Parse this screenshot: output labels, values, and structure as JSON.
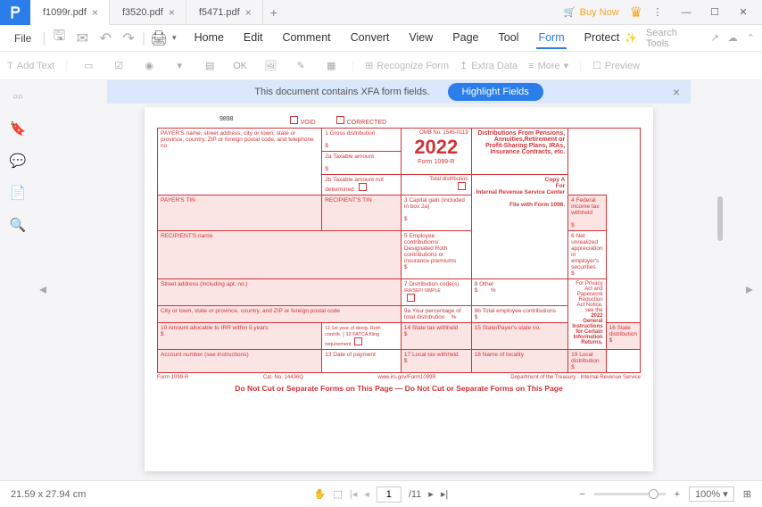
{
  "tabs": [
    {
      "label": "f1099r.pdf",
      "active": true
    },
    {
      "label": "f3520.pdf",
      "active": false
    },
    {
      "label": "f5471.pdf",
      "active": false
    }
  ],
  "buynow": "Buy Now",
  "file_menu": "File",
  "menu": {
    "home": "Home",
    "edit": "Edit",
    "comment": "Comment",
    "convert": "Convert",
    "view": "View",
    "page": "Page",
    "tool": "Tool",
    "form": "Form",
    "protect": "Protect"
  },
  "search_tools": "Search Tools",
  "toolbar": {
    "addtext": "Add Text",
    "recognize": "Recognize Form",
    "extradata": "Extra Data",
    "more": "More",
    "preview": "Preview"
  },
  "xfa": {
    "msg": "This document contains XFA form fields.",
    "btn": "Highlight Fields"
  },
  "form": {
    "num": "9898",
    "void": "VOID",
    "corrected": "CORRECTED",
    "payer_label": "PAYER'S name, street address, city or town, state or province, country, ZIP or foreign postal code, and telephone no.",
    "b1": "1  Gross distribution",
    "omb": "OMB No. 1545-0119",
    "year": "2022",
    "formname": "Form  1099-R",
    "dist_title": "Distributions From Pensions, Annuities,Retirement or Profit-Sharing Plans, IRAs, Insurance Contracts, etc.",
    "b2a": "2a  Taxable amount",
    "b2b": "2b  Taxable amount not determined",
    "totaldist": "Total distribution",
    "copya": "Copy A",
    "for": "For",
    "irs": "Internal Revenue Service Center",
    "file_with": "File with Form 1096.",
    "payer_tin": "PAYER'S TIN",
    "rec_tin": "RECIPIENT'S TIN",
    "b3": "3  Capital gain (included in box 2a)",
    "b4": "4  Federal income tax withheld",
    "rec_name": "RECIPIENT'S name",
    "b5": "5  Employee contributions/ Designated Roth contributions or insurance premiums",
    "b6": "6  Net unrealized appreciation in employer's securities",
    "privacy": "For Privacy Act and Paperwork Reduction Act Notice, see the",
    "geninst": "2022 General Instructions for Certain Information Returns.",
    "street": "Street address (including apt. no.)",
    "b7": "7  Distribution code(s)",
    "irasep": "IRA/SEP/ SIMPLE",
    "b8": "8  Other",
    "city": "City or town, state or province, country, and ZIP or foreign postal code",
    "b9a": "9a  Your percentage of total distribution",
    "b9b": "9b  Total employee contributions",
    "b10": "10  Amount allocable to IRR within 5 years",
    "b11": "11  1st year of desig. Roth contrib.",
    "b12": "12  FATCA filing requirement",
    "b14": "14  State tax withheld",
    "b15": "15  State/Payer's state no.",
    "b16": "16  State distribution",
    "acct": "Account number (see instructions)",
    "b13": "13  Date of payment",
    "b17": "17  Local tax withheld",
    "b18": "18  Name of locality",
    "b19": "19  Local distribution",
    "footer_form": "Form  1099-R",
    "catno": "Cat. No. 14436Q",
    "url": "www.irs.gov/Form1099R",
    "dept": "Department of the Treasury - Internal Revenue Service",
    "donotcut": "Do  Not  Cut  or  Separate  Forms  on  This  Page    —    Do  Not  Cut  or  Separate  Forms  on  This  Page"
  },
  "status": {
    "dims": "21.59 x 27.94 cm",
    "page": "1",
    "total": "/11",
    "zoom": "100%"
  }
}
